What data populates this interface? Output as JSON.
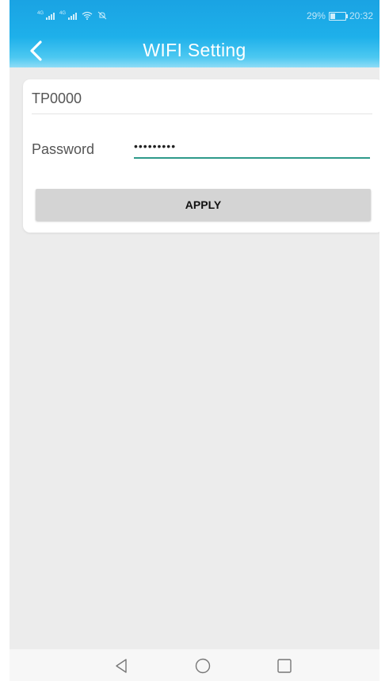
{
  "status_bar": {
    "network_1": "4G",
    "network_2": "4G",
    "battery": "29%",
    "time": "20:32"
  },
  "header": {
    "title": "WIFI Setting",
    "back_icon": "chevron-left-icon"
  },
  "form": {
    "ssid": "TP0000",
    "password_label": "Password",
    "password_value": "•••••••••",
    "apply_label": "APPLY"
  },
  "nav": {
    "back_icon": "triangle-back-icon",
    "home_icon": "circle-home-icon",
    "recents_icon": "square-recents-icon"
  },
  "colors": {
    "header": "#1eb0ea",
    "background": "#ececec",
    "input_underline": "#2e9a8a",
    "button": "#d4d4d4"
  }
}
